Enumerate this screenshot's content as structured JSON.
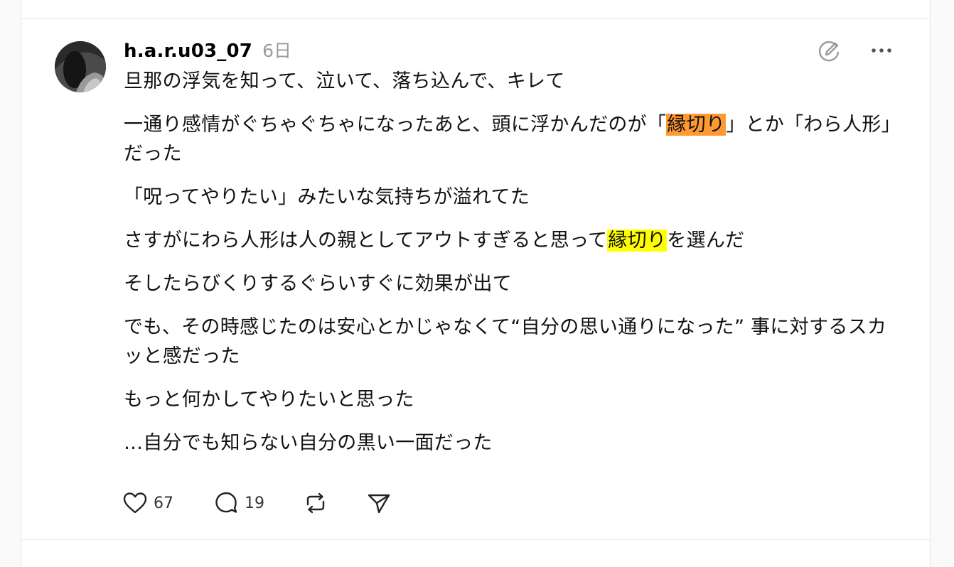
{
  "post": {
    "username": "h.a.r.u03_07",
    "timestamp": "6日",
    "paragraphs": {
      "p1": "旦那の浮気を知って、泣いて、落ち込んで、キレて",
      "p2a": "一通り感情がぐちゃぐちゃになったあと、頭に浮かんだのが「",
      "p2hl": "縁切り",
      "p2b": "」とか「わら人形」だった",
      "p3": "「呪ってやりたい」みたいな気持ちが溢れてた",
      "p4a": "さすがにわら人形は人の親としてアウトすぎると思って",
      "p4hl": "縁切り",
      "p4b": "を選んだ",
      "p5": "そしたらびくりするぐらいすぐに効果が出て",
      "p6": "でも、その時感じたのは安心とかじゃなくて“自分の思い通りになった” 事に対するスカッと感だった",
      "p7": "もっと何かしてやりたいと思った",
      "p8": "…自分でも知らない自分の黒い一面だった"
    },
    "highlight_colors": {
      "orange": "#ff9933",
      "yellow": "#ffff00"
    }
  },
  "actions": {
    "like_count": "67",
    "reply_count": "19"
  },
  "icons": {
    "edit": "edit-pencil-circle-icon",
    "more": "more-dots-icon",
    "like": "heart-icon",
    "reply": "comment-bubble-icon",
    "repost": "repost-icon",
    "share": "send-icon"
  }
}
